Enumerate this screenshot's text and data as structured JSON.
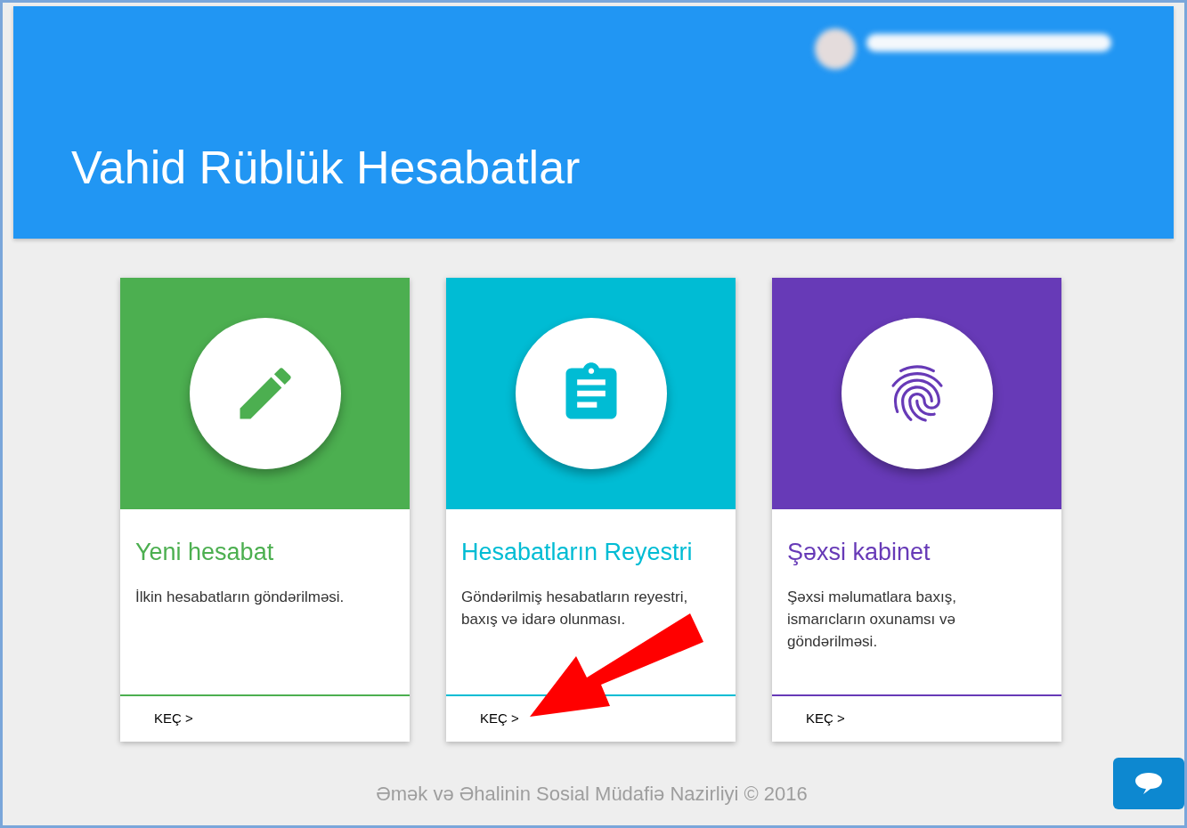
{
  "header": {
    "title": "Vahid Rüblük Hesabatlar"
  },
  "cards": [
    {
      "kind": "pencil",
      "color": "#4caf50",
      "title": "Yeni hesabat",
      "description": "İlkin hesabatların göndərilməsi.",
      "action": "KEÇ >"
    },
    {
      "kind": "clipboard",
      "color": "#00bcd4",
      "title": "Hesabatların Reyestri",
      "description": "Göndərilmiş hesabatların reyestri, baxış və idarə olunması.",
      "action": "KEÇ >"
    },
    {
      "kind": "fingerprint",
      "color": "#673ab7",
      "title": "Şəxsi kabinet",
      "description": "Şəxsi məlumatlara baxış, ismarıcların oxunamsı və göndərilməsi.",
      "action": "KEÇ >"
    }
  ],
  "footer": "Əmək və Əhalinin Sosial Müdafiə Nazirliyi © 2016"
}
